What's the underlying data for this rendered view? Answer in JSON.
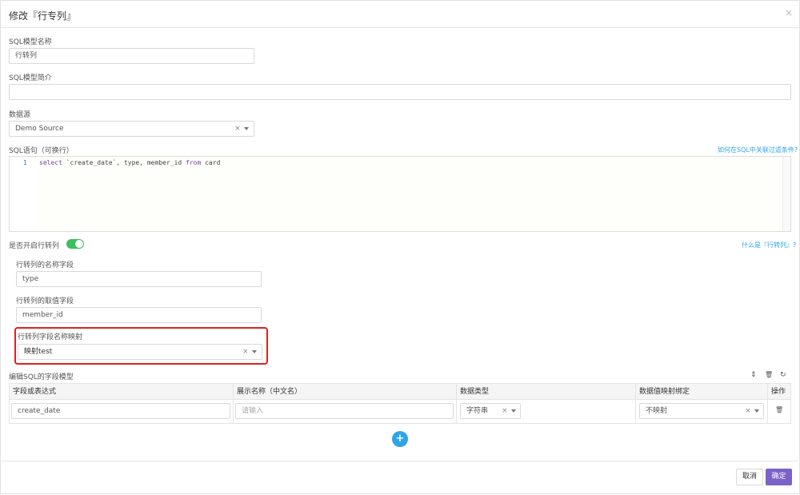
{
  "modal": {
    "title": "修改『行专列』",
    "close_icon": "×"
  },
  "form": {
    "model_name_label": "SQL模型名称",
    "model_name_value": "行转列",
    "model_desc_label": "SQL模型简介",
    "model_desc_value": "",
    "datasource_label": "数据源",
    "datasource_value": "Demo Source",
    "sql_label": "SQL语句（可换行）",
    "sql_help_link": "如何在SQL中关联过滤条件?",
    "sql_line_number": "1",
    "sql_code": {
      "kw1": "select",
      "rest1": " `create_date`, type, member_id ",
      "kw2": "from",
      "rest2": " card"
    },
    "pivot_toggle_label": "是否开启行转列",
    "pivot_toggle_on": true,
    "pivot_help_link": "什么是『行转列』?",
    "pivot_name_field_label": "行转列的名称字段",
    "pivot_name_field_value": "type",
    "pivot_value_field_label": "行转列的取值字段",
    "pivot_value_field_value": "member_id",
    "pivot_mapping_label": "行转列字段名称映射",
    "pivot_mapping_value": "映射test"
  },
  "fields_table": {
    "section_label": "编辑SQL的字段模型",
    "icons": {
      "sort": "⇕",
      "delete": "🗑",
      "refresh": "↻"
    },
    "columns": [
      "字段或表达式",
      "展示名称（中文名）",
      "数据类型",
      "数据值映射绑定",
      "操作"
    ],
    "rows": [
      {
        "expression": "create_date",
        "display_name_placeholder": "请输入",
        "data_type": "字符串",
        "value_mapping": "不映射"
      }
    ],
    "add_button": "+"
  },
  "footer": {
    "cancel_label": "取消",
    "ok_label": "确定"
  },
  "colors": {
    "accent": "#2fa4e7",
    "primary": "#7b62c8",
    "toggle_on": "#3bbf5c",
    "highlight": "#e02020"
  }
}
